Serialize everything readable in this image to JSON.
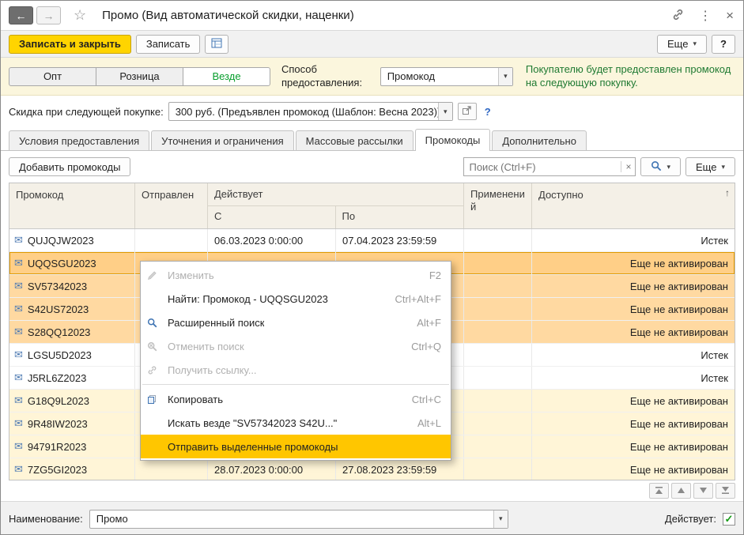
{
  "icons": {
    "back": "←",
    "forward": "→",
    "star": "☆",
    "kebab": "⋮",
    "close": "×",
    "dropdown": "▾",
    "clear": "×",
    "sort_asc": "↑",
    "envelope": "✉",
    "check": "✓"
  },
  "colors": {
    "primary_button": "#ffd400",
    "selection_row": "#ffd9a1",
    "current_row": "#ffcf87",
    "warn_row": "#fff5d7",
    "menu_highlight": "#ffc600",
    "hint_green": "#1f7a32"
  },
  "window": {
    "title": "Промо (Вид автоматической скидки, наценки)"
  },
  "toolbar": {
    "save_close": "Записать и закрыть",
    "save": "Записать",
    "more": "Еще",
    "help": "?"
  },
  "provision": {
    "segments": [
      "Опт",
      "Розница",
      "Везде"
    ],
    "selected_segment": "Везде",
    "method_label": "Способ предоставления:",
    "method_value": "Промокод",
    "hint": "Покупателю будет предоставлен промокод на следующую покупку."
  },
  "next_purchase": {
    "label": "Скидка при следующей покупке:",
    "value": "300 руб. (Предъявлен промокод (Шаблон: Весна 2023))",
    "help": "?"
  },
  "tabs": [
    "Условия предоставления",
    "Уточнения и ограничения",
    "Массовые рассылки",
    "Промокоды",
    "Дополнительно"
  ],
  "active_tab": "Промокоды",
  "list_toolbar": {
    "add": "Добавить промокоды",
    "search_placeholder": "Поиск (Ctrl+F)",
    "more": "Еще"
  },
  "table": {
    "headers": {
      "code": "Промокод",
      "sent": "Отправлен",
      "valid": "Действует",
      "from": "С",
      "to": "По",
      "applied": "Применений",
      "available": "Доступно"
    },
    "rows": [
      {
        "code": "QUJQJW2023",
        "from": "06.03.2023 0:00:00",
        "to": "07.04.2023 23:59:59",
        "available": "Истек",
        "state": "none"
      },
      {
        "code": "UQQSGU2023",
        "from": "",
        "to": "",
        "available": "Еще не активирован",
        "state": "current"
      },
      {
        "code": "SV57342023",
        "from": "",
        "to": "",
        "available": "Еще не активирован",
        "state": "selected"
      },
      {
        "code": "S42US72023",
        "from": "",
        "to": "",
        "available": "Еще не активирован",
        "state": "selected"
      },
      {
        "code": "S28QQ12023",
        "from": "",
        "to": "",
        "available": "Еще не активирован",
        "state": "selected"
      },
      {
        "code": "LGSU5D2023",
        "from": "",
        "to": "",
        "available": "Истек",
        "state": "none"
      },
      {
        "code": "J5RL6Z2023",
        "from": "",
        "to": "",
        "available": "Истек",
        "state": "none"
      },
      {
        "code": "G18Q9L2023",
        "from": "",
        "to": "",
        "available": "Еще не активирован",
        "state": "warn"
      },
      {
        "code": "9R48IW2023",
        "from": "",
        "to": "",
        "available": "Еще не активирован",
        "state": "warn"
      },
      {
        "code": "94791R2023",
        "from": "",
        "to": "",
        "available": "Еще не активирован",
        "state": "warn"
      },
      {
        "code": "7ZG5GI2023",
        "from": "28.07.2023 0:00:00",
        "to": "27.08.2023 23:59:59",
        "available": "Еще не активирован",
        "state": "warn"
      }
    ]
  },
  "context_menu": {
    "items": [
      {
        "label": "Изменить",
        "shortcut": "F2",
        "icon": "pencil-icon",
        "disabled": true,
        "highlighted": false
      },
      {
        "label": "Найти: Промокод - UQQSGU2023",
        "shortcut": "Ctrl+Alt+F",
        "icon": "",
        "disabled": false,
        "highlighted": false
      },
      {
        "label": "Расширенный поиск",
        "shortcut": "Alt+F",
        "icon": "search-icon",
        "disabled": false,
        "highlighted": false
      },
      {
        "label": "Отменить поиск",
        "shortcut": "Ctrl+Q",
        "icon": "search-cancel-icon",
        "disabled": true,
        "highlighted": false
      },
      {
        "label": "Получить ссылку...",
        "shortcut": "",
        "icon": "link-icon",
        "disabled": true,
        "highlighted": false
      },
      {
        "label": "Копировать",
        "shortcut": "Ctrl+C",
        "icon": "copy-icon",
        "disabled": false,
        "highlighted": false
      },
      {
        "label": "Искать везде \"SV57342023 S42U...\"",
        "shortcut": "Alt+L",
        "icon": "",
        "disabled": false,
        "highlighted": false
      },
      {
        "label": "Отправить выделенные промокоды",
        "shortcut": "",
        "icon": "",
        "disabled": false,
        "highlighted": true
      }
    ]
  },
  "footer": {
    "name_label": "Наименование:",
    "name_value": "Промо",
    "active_label": "Действует:",
    "active_checked": true
  }
}
